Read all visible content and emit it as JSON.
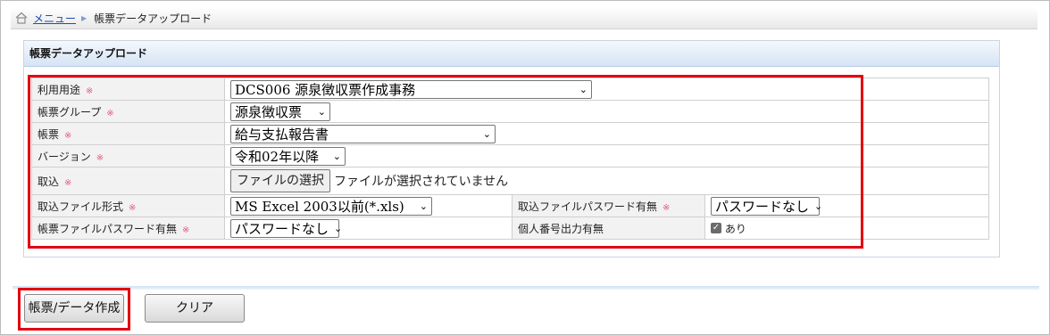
{
  "breadcrumb": {
    "menu_link": "メニュー",
    "current": "帳票データアップロード"
  },
  "panel": {
    "title": "帳票データアップロード"
  },
  "form": {
    "required_mark": "※",
    "usage": {
      "label": "利用用途",
      "value": "DCS006 源泉徴収票作成事務"
    },
    "group": {
      "label": "帳票グループ",
      "value": "源泉徴収票"
    },
    "form_type": {
      "label": "帳票",
      "value": "給与支払報告書"
    },
    "version": {
      "label": "バージョン",
      "value": "令和02年以降"
    },
    "import": {
      "label": "取込",
      "button": "ファイルの選択",
      "status": "ファイルが選択されていません"
    },
    "file_format": {
      "label": "取込ファイル形式",
      "value": "MS Excel 2003以前(*.xls)"
    },
    "import_password": {
      "label": "取込ファイルパスワード有無",
      "value": "パスワードなし"
    },
    "report_password": {
      "label": "帳票ファイルパスワード有無",
      "value": "パスワードなし"
    },
    "my_number": {
      "label": "個人番号出力有無",
      "value": "あり",
      "checked": true
    }
  },
  "buttons": {
    "create": "帳票/データ作成",
    "clear": "クリア"
  },
  "colors": {
    "highlight": "#e3000f",
    "required": "#e35a7a",
    "link": "#1a4fb5"
  }
}
